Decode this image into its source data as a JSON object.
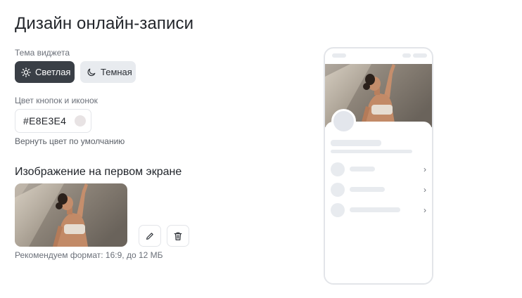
{
  "page": {
    "title": "Дизайн онлайн-записи"
  },
  "theme": {
    "label": "Тема виджета",
    "light_label": "Светлая",
    "dark_label": "Темная",
    "selected": "light",
    "selected_color": "#3a3f46"
  },
  "color": {
    "label": "Цвет кнопок и иконок",
    "value": "#E8E3E4",
    "swatch": "#E8E3E4",
    "reset_label": "Вернуть цвет по умолчанию"
  },
  "image": {
    "section_title": "Изображение на первом экране",
    "hint": "Рекомендуем формат: 16:9, до 12 МБ",
    "edit_icon": "pencil-icon",
    "delete_icon": "trash-icon"
  },
  "preview": {
    "rows": [
      {
        "chevron": "›"
      },
      {
        "chevron": "›"
      },
      {
        "chevron": "›"
      }
    ]
  }
}
